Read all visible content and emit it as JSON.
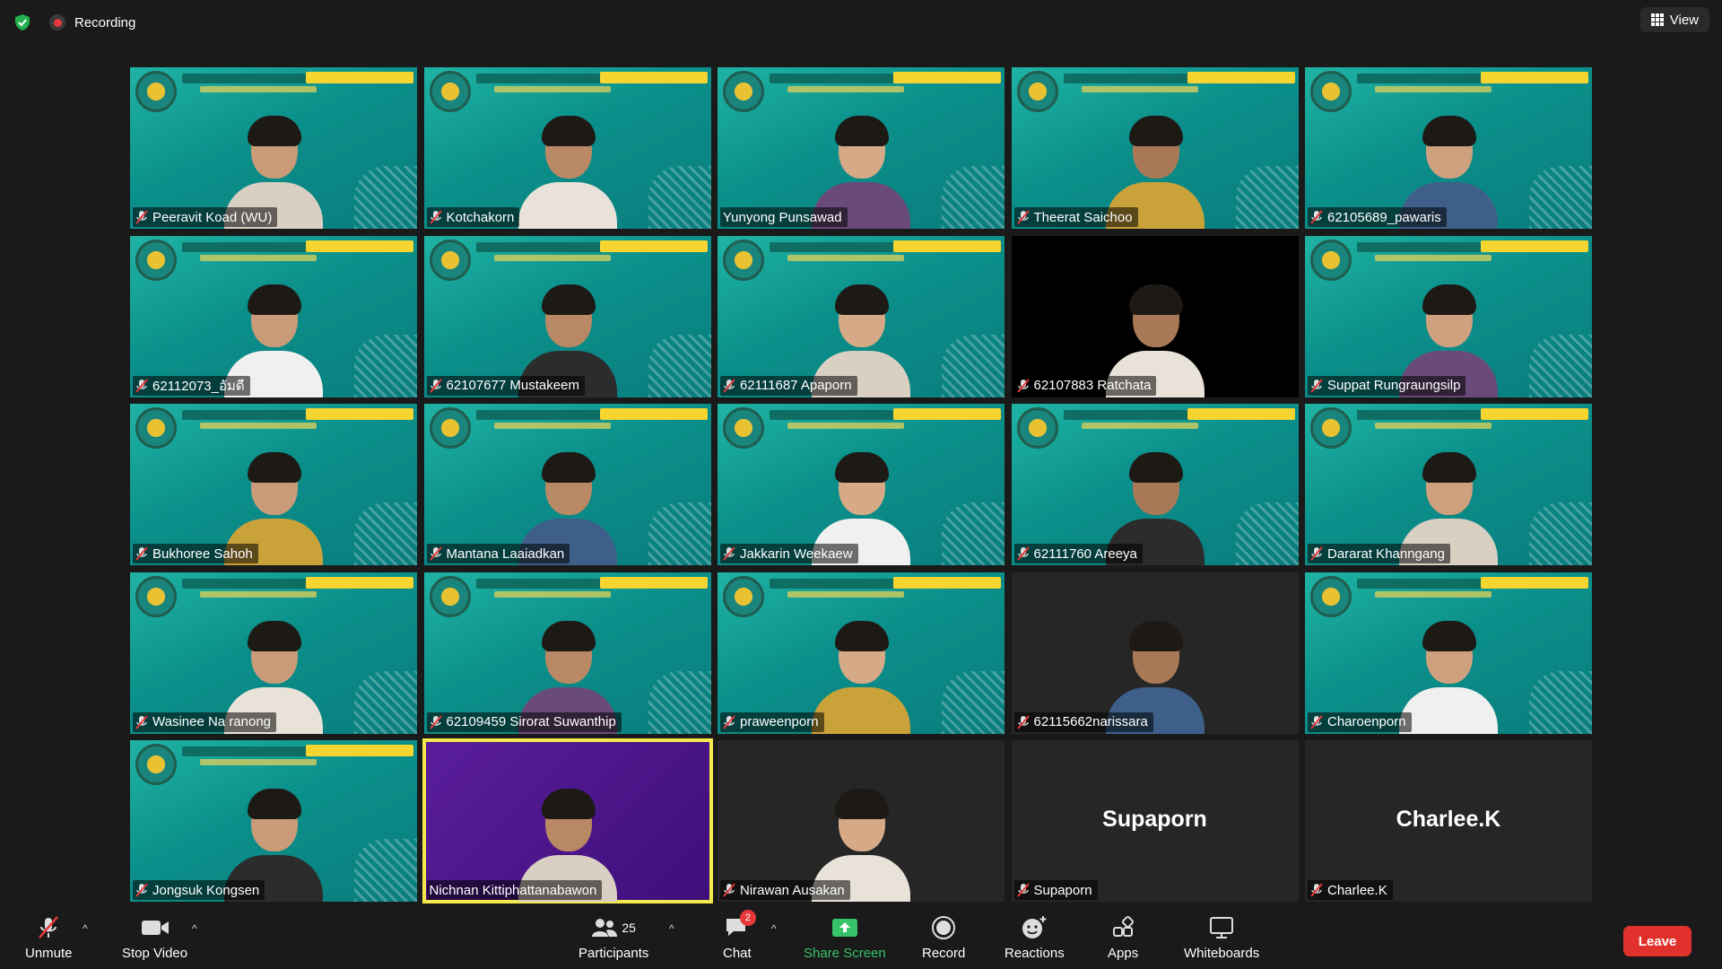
{
  "top": {
    "recording_label": "Recording",
    "view_label": "View"
  },
  "participants": [
    {
      "name": "Peeravit Koad (WU)",
      "bg": "teal"
    },
    {
      "name": "Kotchakorn",
      "bg": "teal"
    },
    {
      "name": "Yunyong Punsawad",
      "bg": "teal",
      "muted": false
    },
    {
      "name": "Theerat Saichoo",
      "bg": "teal"
    },
    {
      "name": "62105689_pawaris",
      "bg": "teal"
    },
    {
      "name": "62112073_อัมดี",
      "bg": "teal"
    },
    {
      "name": "62107677 Mustakeem",
      "bg": "teal"
    },
    {
      "name": "62111687 Apaporn",
      "bg": "teal"
    },
    {
      "name": "62107883 Ratchata",
      "bg": "black"
    },
    {
      "name": "Suppat Rungraungsilp",
      "bg": "teal"
    },
    {
      "name": "Bukhoree Sahoh",
      "bg": "teal"
    },
    {
      "name": "Mantana Laaiadkan",
      "bg": "teal"
    },
    {
      "name": "Jakkarin Weekaew",
      "bg": "teal"
    },
    {
      "name": "62111760 Areeya",
      "bg": "teal"
    },
    {
      "name": "Dararat Khanngang",
      "bg": "teal"
    },
    {
      "name": "Wasinee Na ranong",
      "bg": "teal"
    },
    {
      "name": "62109459 Sirorat Suwanthip",
      "bg": "teal"
    },
    {
      "name": "praweenporn",
      "bg": "teal"
    },
    {
      "name": "62115662narissara",
      "bg": "dark"
    },
    {
      "name": "Charoenporn",
      "bg": "teal"
    },
    {
      "name": "Jongsuk Kongsen",
      "bg": "teal"
    },
    {
      "name": "Nichnan Kittiphattanabawon",
      "bg": "purple",
      "muted": false,
      "active": true
    },
    {
      "name": "Nirawan Ausakan",
      "bg": "dark"
    },
    {
      "name": "Supaporn",
      "bg": "dark",
      "avatar_text": "Supaporn"
    },
    {
      "name": "Charlee.K",
      "bg": "dark",
      "avatar_text": "Charlee.K"
    }
  ],
  "toolbar": {
    "unmute_label": "Unmute",
    "stop_video_label": "Stop Video",
    "participants_label": "Participants",
    "participants_count": "25",
    "chat_label": "Chat",
    "chat_badge": "2",
    "share_label": "Share Screen",
    "record_label": "Record",
    "reactions_label": "Reactions",
    "apps_label": "Apps",
    "whiteboards_label": "Whiteboards",
    "leave_label": "Leave"
  },
  "colors": {
    "share_accent": "#36c36a",
    "leave_red": "#e0312c",
    "active_speaker": "#f5e94c"
  }
}
